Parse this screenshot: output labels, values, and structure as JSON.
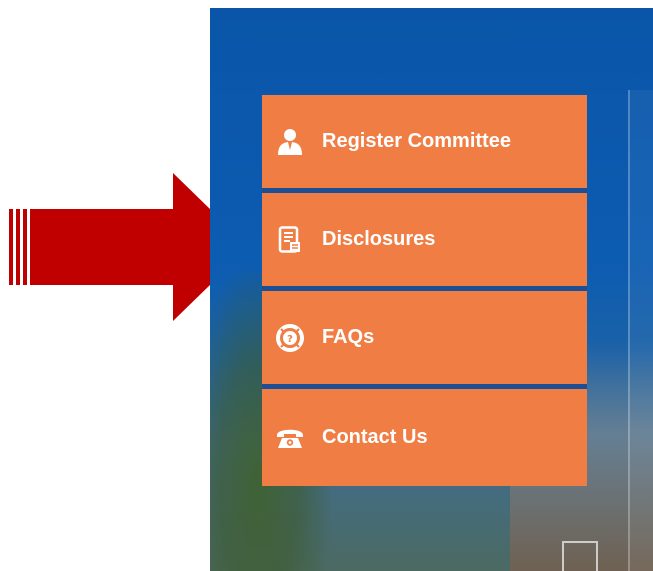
{
  "menu": {
    "items": [
      {
        "label": "Register Committee",
        "icon": "person-icon"
      },
      {
        "label": "Disclosures",
        "icon": "document-icon"
      },
      {
        "label": "FAQs",
        "icon": "help-lifebuoy-icon"
      },
      {
        "label": "Contact Us",
        "icon": "telephone-icon"
      }
    ]
  },
  "colors": {
    "menu_item_bg": "#ef7d44",
    "panel_blue": "#0a55a8",
    "arrow_red": "#c00000",
    "divider": "#1c4f93"
  },
  "annotation": {
    "arrow_target": "Disclosures"
  }
}
